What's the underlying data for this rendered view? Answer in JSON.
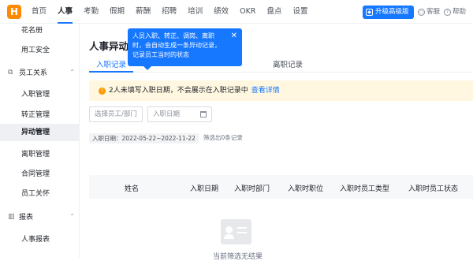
{
  "topbar": {
    "logo": "H",
    "nav": [
      "首页",
      "人事",
      "考勤",
      "假期",
      "薪酬",
      "招聘",
      "培训",
      "绩效",
      "OKR",
      "盘点",
      "设置"
    ],
    "active_nav": "人事",
    "upgrade_label": "升级高级版",
    "service_label": "客服",
    "help_label": "帮助"
  },
  "sidebar": {
    "items": [
      {
        "label": "花名册"
      },
      {
        "label": "用工安全"
      },
      {
        "label": "员工关系"
      },
      {
        "label": "入职管理"
      },
      {
        "label": "转正管理"
      },
      {
        "label": "异动管理"
      },
      {
        "label": "离职管理"
      },
      {
        "label": "合同管理"
      },
      {
        "label": "员工关怀"
      },
      {
        "label": "报表"
      },
      {
        "label": "人事报表"
      }
    ]
  },
  "main": {
    "title": "人事异动管",
    "tabs": [
      "入职记录",
      "离职记录"
    ],
    "active_tab": "入职记录",
    "tooltip": "人员入职、转正、调岗、离职时，会自动生成一条异动记录，记录员工当时的状态",
    "notice": {
      "text": "2人未填写入职日期，不会展示在入职记录中",
      "link": "查看详情"
    },
    "filters": {
      "employee_placeholder": "选择员工/部门",
      "date_placeholder": "入职日期"
    },
    "criteria": {
      "range": "入职日期：2022-05-22~2022-11-22",
      "count": "筛选出0条记录"
    },
    "table_headers": [
      "姓名",
      "入职日期",
      "入职时部门",
      "入职时职位",
      "入职时员工类型",
      "入职时员工状态"
    ],
    "empty_text": "当前筛选无结果"
  }
}
